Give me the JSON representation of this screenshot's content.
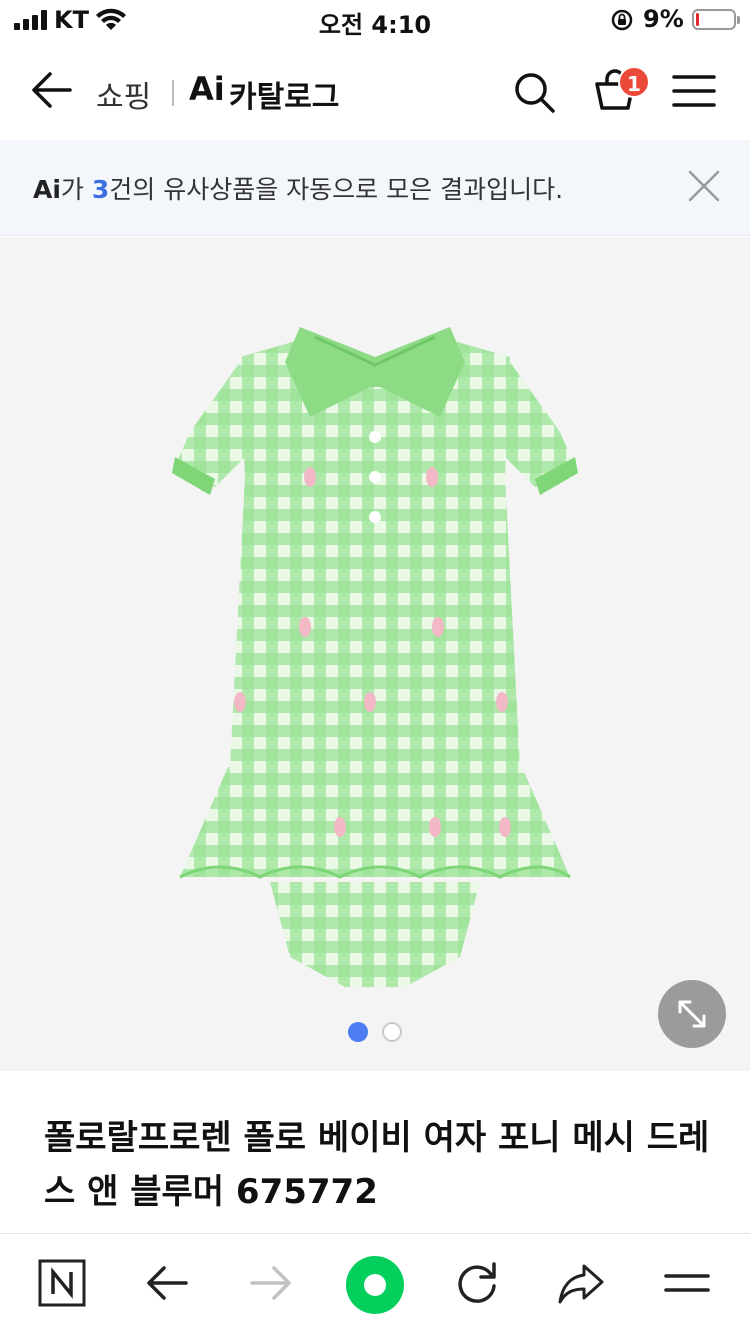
{
  "status_bar": {
    "carrier": "KT",
    "time": "오전 4:10",
    "battery_percent": "9%",
    "battery_level": 0.09
  },
  "header": {
    "back_icon": "arrow-left-icon",
    "section": "쇼핑",
    "ai_label": "Ai",
    "title": "카탈로그",
    "search_icon": "search-icon",
    "cart_icon": "shopping-bag-icon",
    "cart_count": "1",
    "menu_icon": "hamburger-menu-icon"
  },
  "notice": {
    "ai_label": "Ai",
    "prefix": "가 ",
    "count": "3",
    "suffix": "건의 유사상품을 자동으로 모은 결과입니다.",
    "close_icon": "close-icon"
  },
  "product": {
    "image_icon": "green-gingham-polo-dress-image",
    "expand_icon": "expand-arrows-icon",
    "image_page": 1,
    "image_total": 2,
    "title": "폴로랄프로렌 폴로 베이비 여자 포니 메시 드레스 앤 블루머 675772",
    "colors": {
      "dress_green": "#7fd67e",
      "collar_green": "#8ddc85",
      "pony_pink": "#f2b8c6"
    }
  },
  "toolbar": {
    "items": [
      "naver-n-icon",
      "arrow-back-icon",
      "arrow-forward-icon",
      "home-circle-icon",
      "reload-icon",
      "share-icon",
      "menu-lines-icon"
    ]
  },
  "colors": {
    "accent_blue": "#3e6fe0",
    "badge_red": "#ec4a38",
    "naver_green": "#03cf5d",
    "notice_bg": "#f3f7fb"
  }
}
